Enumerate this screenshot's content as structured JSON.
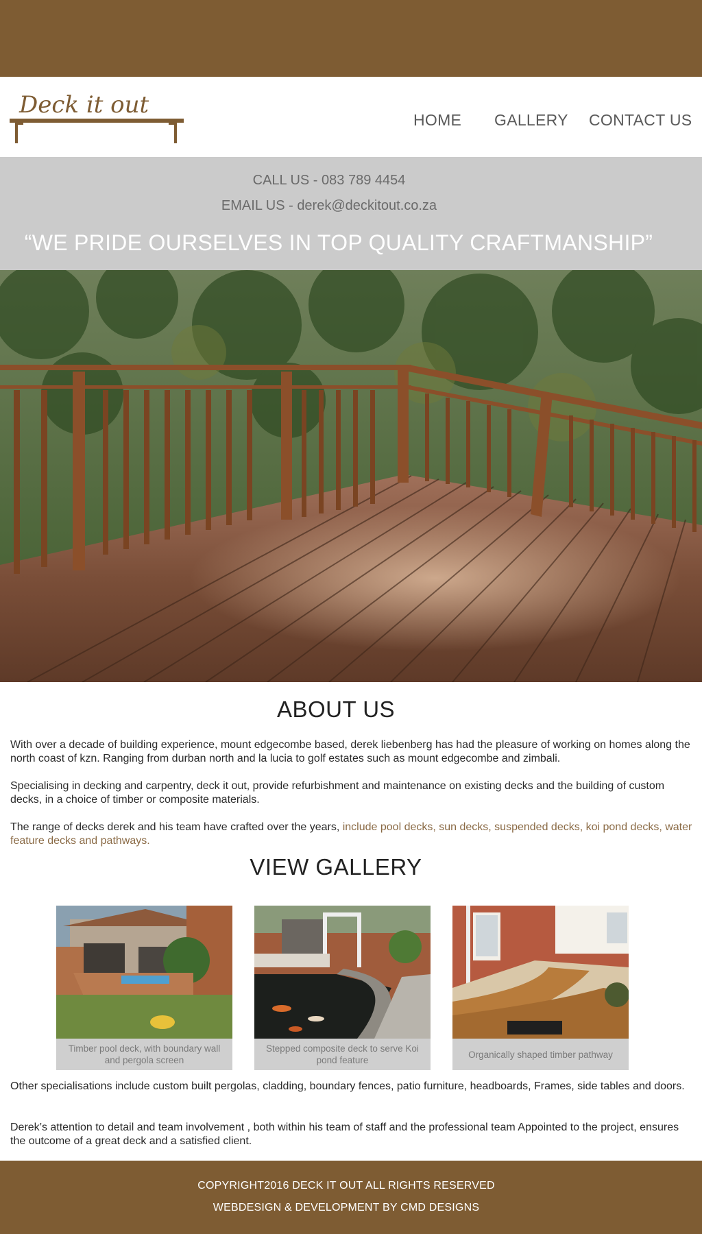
{
  "brand": {
    "logo_text": "Deck it out"
  },
  "nav": {
    "home": "HOME",
    "gallery": "GALLERY",
    "contact": "CONTACT US"
  },
  "contact": {
    "call": "CALL US - 083 789 4454",
    "email": "EMAIL US - derek@deckitout.co.za",
    "tagline": "“WE PRIDE OURSELVES IN TOP QUALITY CRAFTMANSHIP”"
  },
  "about": {
    "title": "ABOUT US",
    "p1": "With over a decade of building experience, mount edgecombe based, derek liebenberg has had the pleasure of working on homes along the north coast of kzn. Ranging from durban north and la lucia to golf estates such as mount edgecombe and zimbali.",
    "p2": "Specialising in decking and carpentry, deck it out, provide refurbishment and maintenance on existing decks  and the building of custom decks, in a choice of timber or composite materials.",
    "p3_start": "The range of decks derek and his team have crafted over the years, ",
    "p3_accent": "include pool decks, sun decks,  suspended decks, koi pond decks, water feature decks and pathways."
  },
  "gallery": {
    "title": "VIEW GALLERY",
    "items": [
      {
        "caption": "Timber pool deck, with boundary wall and pergola screen"
      },
      {
        "caption": "Stepped composite deck to serve Koi pond feature"
      },
      {
        "caption": "Organically shaped timber pathway"
      }
    ]
  },
  "more": {
    "p1": "Other specialisations  include custom built pergolas, cladding, boundary fences, patio furniture, headboards, Frames, side tables and doors.",
    "p2": "Derek’s attention to detail and team involvement , both within his team  of staff and the professional team  Appointed to the project, ensures the outcome of a great deck and a satisfied client."
  },
  "footer": {
    "copyright": "COPYRIGHT2016 DECK IT OUT ALL RIGHTS RESERVED",
    "credit": "WEBDESIGN & DEVELOPMENT BY CMD DESIGNS"
  },
  "colors": {
    "brand_brown": "#7e5c33",
    "band_grey": "#cbcbcb",
    "accent": "#8a6a45"
  }
}
